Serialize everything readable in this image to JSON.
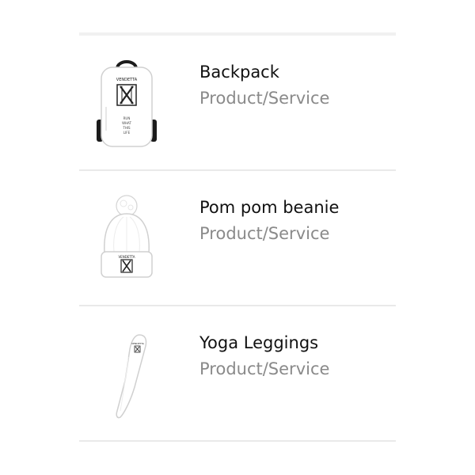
{
  "products": [
    {
      "name": "Backpack",
      "category": "Product/Service",
      "icon": "backpack-image",
      "brand_text": "VENDETTA",
      "print_text": "RUN\nWHAT\nTHIS\nLIFE"
    },
    {
      "name": "Pom pom beanie",
      "category": "Product/Service",
      "icon": "beanie-image",
      "brand_text": "VENDETTA"
    },
    {
      "name": "Yoga Leggings",
      "category": "Product/Service",
      "icon": "leggings-image",
      "brand_text": "VENDETTA"
    }
  ],
  "colors": {
    "title": "#111111",
    "subtitle": "#8a8a8a",
    "divider": "#e9e9e9",
    "product_fill": "#ffffff",
    "product_edge": "#d0d0d0",
    "strap": "#1b1b1b"
  }
}
